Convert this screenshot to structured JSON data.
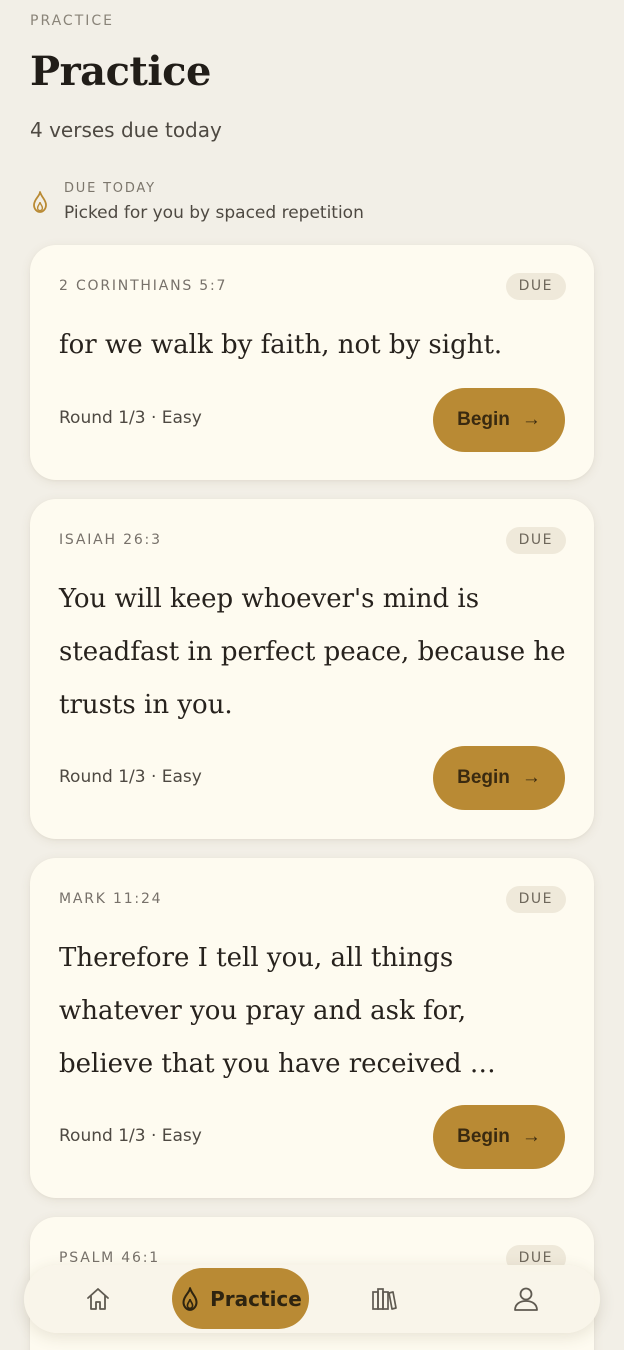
{
  "header": {
    "eyebrow": "PRACTICE",
    "title": "Practice",
    "subtitle": "4 verses due today"
  },
  "due_banner": {
    "icon": "flame-icon",
    "label": "DUE TODAY",
    "description": "Picked for you by spaced repetition"
  },
  "cards": [
    {
      "reference": "2 CORINTHIANS 5:7",
      "badge": "DUE",
      "verse": "for we walk by faith, not by sight.",
      "meta": "Round 1/3 · Easy",
      "button_label": "Begin",
      "button_icon": "→"
    },
    {
      "reference": "ISAIAH 26:3",
      "badge": "DUE",
      "verse": "You will keep whoever's mind is steadfast in perfect peace, because he trusts in you.",
      "meta": "Round 1/3 · Easy",
      "button_label": "Begin",
      "button_icon": "→"
    },
    {
      "reference": "MARK 11:24",
      "badge": "DUE",
      "verse": "Therefore I tell you, all things whatever you pray and ask for, believe that you have received …",
      "meta": "Round 1/3 · Easy",
      "button_label": "Begin",
      "button_icon": "→"
    },
    {
      "reference": "PSALM 46:1",
      "badge": "DUE"
    }
  ],
  "nav": {
    "items": [
      {
        "icon": "home-icon"
      },
      {
        "icon": "flame-icon",
        "label": "Practice",
        "active": true
      },
      {
        "icon": "library-icon"
      },
      {
        "icon": "profile-icon"
      }
    ]
  },
  "colors": {
    "background": "#f2efe7",
    "card": "#fefbf0",
    "accent": "#b98a34",
    "badge_bg": "#efe9da"
  }
}
